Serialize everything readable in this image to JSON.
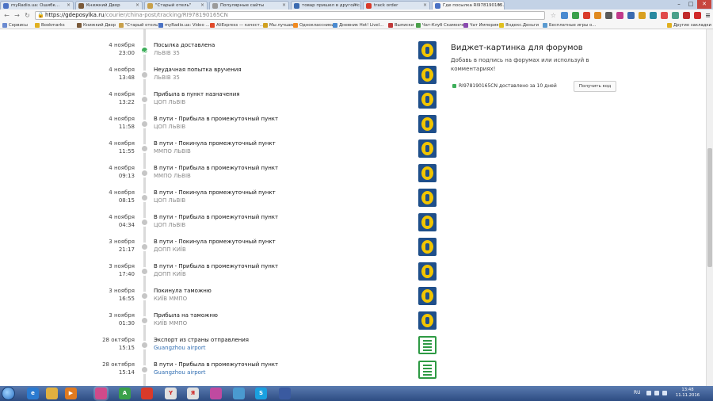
{
  "browser": {
    "tabs": [
      {
        "title": "myRadio.ua: Ошибк...",
        "color": "#4a72c4"
      },
      {
        "title": "Книжкий Двор",
        "color": "#7a5a3a"
      },
      {
        "title": "\"Старый отель\"",
        "color": "#c8a04a"
      },
      {
        "title": "Популярные сайты",
        "color": "#9a9a9a"
      },
      {
        "title": "товар пришел в другой с...",
        "color": "#3a6ab0"
      },
      {
        "title": "track order",
        "color": "#d93a2a"
      },
      {
        "title": "Где посылка RI978190165...",
        "color": "#4a72c4"
      }
    ],
    "url_host": "https://gdeposylka.ru",
    "url_path": "/courier/china-post/tracking/RI978190165CN",
    "bookmarks": [
      {
        "label": "Сервисы",
        "color": "#6a8ad0"
      },
      {
        "label": "Bookmarks",
        "color": "#e0b020"
      },
      {
        "label": "Книжкий Двор",
        "color": "#7a5a3a"
      },
      {
        "label": "\"Старый отель\"",
        "color": "#c8a04a"
      },
      {
        "label": "myRadio.ua: Video ...",
        "color": "#4a72c4"
      },
      {
        "label": "AliExpress — качест...",
        "color": "#e04a2a"
      },
      {
        "label": "Мы лучшие!",
        "color": "#d0a020"
      },
      {
        "label": "Одноклассники",
        "color": "#f08a20"
      },
      {
        "label": "Дневник Hot! LiveI...",
        "color": "#4a8ad0"
      },
      {
        "label": "Выписки",
        "color": "#c03a3a"
      },
      {
        "label": "Чат-Клуб Скамеечка",
        "color": "#4aa04a"
      },
      {
        "label": "Чат Империя",
        "color": "#8a4ab0"
      },
      {
        "label": "Яндекс.Деньги",
        "color": "#e0c020"
      },
      {
        "label": "Бесплатные игры о...",
        "color": "#5a9ad0"
      },
      {
        "label": "Другие закладки",
        "color": "#e0b020"
      }
    ]
  },
  "tracking": {
    "events": [
      {
        "date": "4 ноября",
        "time": "23:00",
        "status": "Посылка доставлена",
        "location": "ЛЬВІВ 35",
        "done": true,
        "logo": "ukrposhta-logo-icon",
        "link": false
      },
      {
        "date": "4 ноября",
        "time": "13:48",
        "status": "Неудачная попытка вручения",
        "location": "ЛЬВІВ 35",
        "done": false,
        "logo": "ukrposhta-logo-icon",
        "link": false
      },
      {
        "date": "4 ноября",
        "time": "13:22",
        "status": "Прибыла в пункт назначения",
        "location": "ЦОП ЛЬВІВ",
        "done": false,
        "logo": "ukrposhta-logo-icon",
        "link": false
      },
      {
        "date": "4 ноября",
        "time": "11:58",
        "status": "В пути - Прибыла в промежуточный пункт",
        "location": "ЦОП ЛЬВІВ",
        "done": false,
        "logo": "ukrposhta-logo-icon",
        "link": false
      },
      {
        "date": "4 ноября",
        "time": "11:55",
        "status": "В пути - Покинула промежуточный пункт",
        "location": "ММПО ЛЬВІВ",
        "done": false,
        "logo": "ukrposhta-logo-icon",
        "link": false
      },
      {
        "date": "4 ноября",
        "time": "09:13",
        "status": "В пути - Прибыла в промежуточный пункт",
        "location": "ММПО ЛЬВІВ",
        "done": false,
        "logo": "ukrposhta-logo-icon",
        "link": false
      },
      {
        "date": "4 ноября",
        "time": "08:15",
        "status": "В пути - Покинула промежуточный пункт",
        "location": "ЦОП ЛЬВІВ",
        "done": false,
        "logo": "ukrposhta-logo-icon",
        "link": false
      },
      {
        "date": "4 ноября",
        "time": "04:34",
        "status": "В пути - Прибыла в промежуточный пункт",
        "location": "ЦОП ЛЬВІВ",
        "done": false,
        "logo": "ukrposhta-logo-icon",
        "link": false
      },
      {
        "date": "3 ноября",
        "time": "21:17",
        "status": "В пути - Покинула промежуточный пункт",
        "location": "ДОПП КИЇВ",
        "done": false,
        "logo": "ukrposhta-logo-icon",
        "link": false
      },
      {
        "date": "3 ноября",
        "time": "17:40",
        "status": "В пути - Прибыла в промежуточный пункт",
        "location": "ДОПП КИЇВ",
        "done": false,
        "logo": "ukrposhta-logo-icon",
        "link": false
      },
      {
        "date": "3 ноября",
        "time": "16:55",
        "status": "Покинула таможню",
        "location": "КИЇВ ММПО",
        "done": false,
        "logo": "ukrposhta-logo-icon",
        "link": false
      },
      {
        "date": "3 ноября",
        "time": "01:30",
        "status": "Прибыла на таможню",
        "location": "КИЇВ ММПО",
        "done": false,
        "logo": "ukrposhta-logo-icon",
        "link": false
      },
      {
        "date": "28 октября",
        "time": "15:15",
        "status": "Экспорт из страны отправления",
        "location": "Guangzhou airport",
        "done": false,
        "logo": "china-post-logo-icon",
        "link": true
      },
      {
        "date": "28 октября",
        "time": "15:14",
        "status": "В пути - Прибыла в промежуточный пункт",
        "location": "Guangzhou airport",
        "done": false,
        "logo": "china-post-logo-icon",
        "link": true
      }
    ]
  },
  "widget": {
    "title": "Виджет-картинка для форумов",
    "description": "Добавь в подпись на форумах или используй в комментариях!",
    "badge_text": "RI978190165CN доставлено за 10 дней",
    "button_label": "Получить код"
  },
  "taskbar": {
    "language": "RU",
    "time": "13:48",
    "date": "11.11.2016"
  }
}
